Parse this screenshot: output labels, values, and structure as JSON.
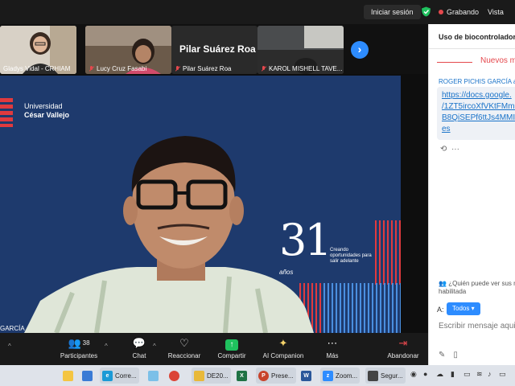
{
  "topbar": {
    "signin_label": "Iniciar sesión",
    "recording_label": "Grabando",
    "view_label": "Vista"
  },
  "thumbnails": [
    {
      "name": "Gladys Vidal - CRHIAM",
      "muted": false
    },
    {
      "name": "Lucy Cruz Fasabi",
      "muted": true
    },
    {
      "name": "Pilar Suárez Roa",
      "display_name": "Pilar Suárez Roa",
      "muted": true
    },
    {
      "name": "KAROL MISHELL TAVE...",
      "muted": true
    }
  ],
  "main": {
    "logo": {
      "line1": "Universidad",
      "line2": "César Vallejo"
    },
    "anniversary_number": "31",
    "anniversary_word": "años",
    "tagline": "Creando oportunidades para salir adelante",
    "speaker_label": "GARCÍA"
  },
  "chat": {
    "title": "Uso de biocontrolador",
    "new_messages": "Nuevos m",
    "sender": "ROGER PICHIS GARCÍA a",
    "link_lines": [
      "https://docs.google.",
      "/1ZT5ircoXfVKtFMml",
      "B8QiSEPf6ttJs4MMI/",
      "es"
    ],
    "privacy_note": "¿Quién puede ver sus m habilitada",
    "to_label": "A:",
    "to_value": "Todos",
    "input_placeholder": "Escribir mensaje aqui"
  },
  "toolbar": {
    "participants_label": "Participantes",
    "participants_count": "38",
    "chat_label": "Chat",
    "react_label": "Reaccionar",
    "share_label": "Compartir",
    "ai_label": "AI Companion",
    "more_label": "Más",
    "leave_label": "Abandonar"
  },
  "taskbar": {
    "items": [
      "Corre...",
      "DE20...",
      "Prese...",
      "Zoom...",
      "Segur..."
    ]
  },
  "colors": {
    "accent": "#2d8cff",
    "record": "#e5484d",
    "slide_bg": "#1e3a6d",
    "share_green": "#1fc15e"
  }
}
